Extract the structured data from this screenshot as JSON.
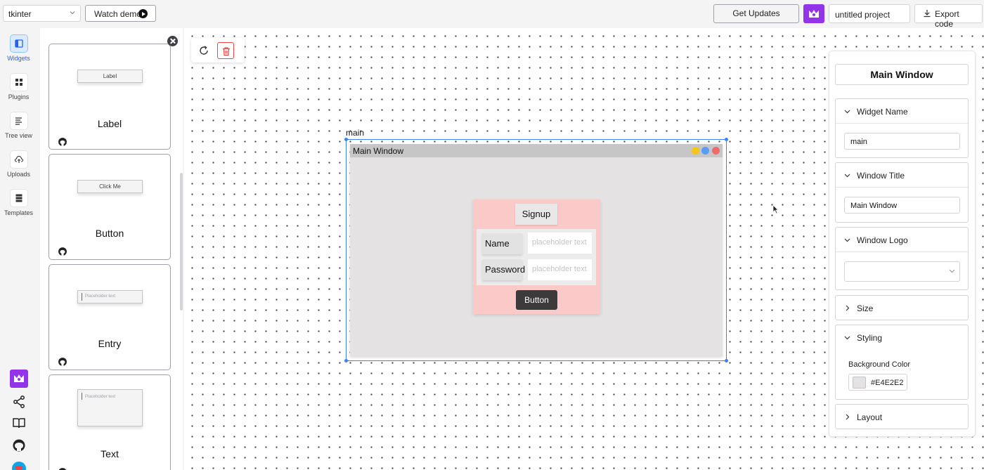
{
  "topbar": {
    "framework": "tkinter",
    "watch_demo": "Watch demo",
    "get_updates": "Get Updates",
    "project_name": "untitled project",
    "export_code": "Export code"
  },
  "sidebar": {
    "items": [
      {
        "label": "Widgets",
        "icon": "widgets-icon",
        "active": true
      },
      {
        "label": "Plugins",
        "icon": "plugins-icon"
      },
      {
        "label": "Tree view",
        "icon": "tree-view-icon"
      },
      {
        "label": "Uploads",
        "icon": "uploads-icon"
      },
      {
        "label": "Templates",
        "icon": "templates-icon"
      }
    ]
  },
  "widget_panel": {
    "cards": [
      {
        "name": "Label",
        "preview": "Label"
      },
      {
        "name": "Button",
        "preview": "Click Me"
      },
      {
        "name": "Entry",
        "preview": "Placeholder text"
      },
      {
        "name": "Text",
        "preview": "Placeholder text"
      }
    ]
  },
  "canvas": {
    "widget_id": "main",
    "window_title": "Main Window",
    "title_dots": [
      "#f5c518",
      "#5b9cf5",
      "#ef6a6a"
    ],
    "form": {
      "heading": "Signup",
      "name_label": "Name",
      "name_placeholder": "placeholder text",
      "password_label": "Password",
      "password_placeholder": "placeholder text",
      "button_label": "Button"
    }
  },
  "properties": {
    "title": "Main Window",
    "widget_name_label": "Widget Name",
    "widget_name_value": "main",
    "window_title_label": "Window Title",
    "window_title_value": "Main Window",
    "window_logo_label": "Window Logo",
    "size_label": "Size",
    "styling_label": "Styling",
    "background_color_label": "Background Color",
    "background_color_value": "#E4E2E2",
    "layout_label": "Layout"
  },
  "colors": {
    "accent": "#9333ea",
    "selection": "#3b82f6",
    "window_bg": "#E4E2E2",
    "frame_bg": "#fcc9c9",
    "button_bg": "#3c3a3a"
  }
}
